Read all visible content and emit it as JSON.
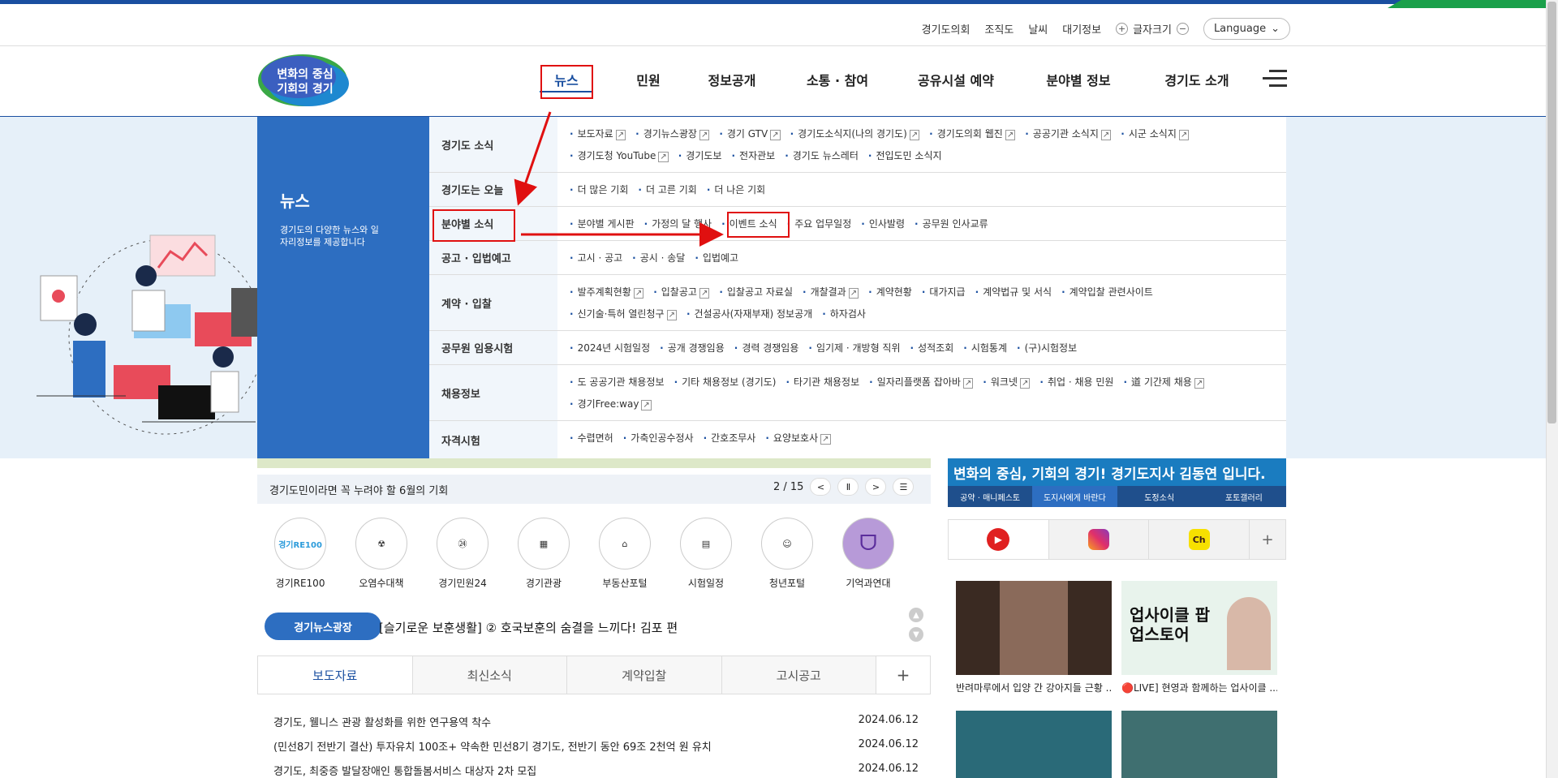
{
  "util": {
    "links": [
      "경기도의회",
      "조직도",
      "날씨",
      "대기정보"
    ],
    "fontsize_label": "글자크기",
    "language": "Language"
  },
  "logo": {
    "line1": "변화의 중심",
    "line2": "기회의 경기"
  },
  "gnb": [
    "뉴스",
    "민원",
    "정보공개",
    "소통 · 참여",
    "공유시설 예약",
    "분야별 정보",
    "경기도 소개"
  ],
  "mega": {
    "title": "뉴스",
    "desc": "경기도의 다양한 뉴스와 일자리정보를 제공합니다",
    "rows": [
      {
        "cat": "경기도 소식",
        "items": [
          "보도자료",
          "경기뉴스광장",
          "경기 GTV",
          "경기도소식지(나의 경기도)",
          "경기도의회 웹진",
          "공공기관 소식지",
          "시군 소식지",
          "경기도청 YouTube",
          "경기도보",
          "전자관보",
          "경기도 뉴스레터",
          "전입도민 소식지"
        ]
      },
      {
        "cat": "경기도는 오늘",
        "items": [
          "더 많은 기회",
          "더 고른 기회",
          "더 나은 기회"
        ]
      },
      {
        "cat": "분야별 소식",
        "items": [
          "분야별 게시판",
          "가정의 달 행사",
          "이벤트 소식",
          "주요 업무일정",
          "인사발령",
          "공무원 인사교류"
        ]
      },
      {
        "cat": "공고 · 입법예고",
        "items": [
          "고시 · 공고",
          "공시 · 송달",
          "입법예고"
        ]
      },
      {
        "cat": "계약 · 입찰",
        "items": [
          "발주계획현황",
          "입찰공고",
          "입찰공고 자료실",
          "개찰결과",
          "계약현황",
          "대가지급",
          "계약법규 및 서식",
          "계약입찰 관련사이트",
          "신기술·특허 열린청구",
          "건설공사(자재부재) 정보공개",
          "하자검사"
        ]
      },
      {
        "cat": "공무원 임용시험",
        "items": [
          "2024년 시험일정",
          "공개 경쟁임용",
          "경력 경쟁임용",
          "임기제 · 개방형 직위",
          "성적조회",
          "시험통계",
          "(구)시험정보"
        ]
      },
      {
        "cat": "채용정보",
        "items": [
          "도 공공기관 채용정보",
          "기타 채용정보 (경기도)",
          "타기관 채용정보",
          "일자리플랫폼 잡아바",
          "워크넷",
          "취업 · 채용 민원",
          "道 기간제 채용",
          "경기Free:way"
        ]
      },
      {
        "cat": "자격시험",
        "items": [
          "수렵면허",
          "가축인공수정사",
          "간호조무사",
          "요양보호사"
        ]
      }
    ]
  },
  "slider": {
    "text": "경기도민이라면 꼭 누려야 할 6월의 기회",
    "counter": "2 / 15"
  },
  "quick": [
    "경기RE100",
    "오염수대책",
    "경기민원24",
    "경기관광",
    "부동산포털",
    "시험일정",
    "청년포털",
    "기억과연대"
  ],
  "quick_icon_text": {
    "re100": "경기RE100"
  },
  "newsplaza": {
    "badge": "경기뉴스광장",
    "headline": "[슬기로운 보훈생활] ② 호국보훈의 숨결을 느끼다! 김포 편"
  },
  "tabs": [
    "보도자료",
    "최신소식",
    "계약입찰",
    "고시공고",
    "+"
  ],
  "news": [
    {
      "title": "경기도, 웰니스 관광 활성화를 위한 연구용역 착수",
      "date": "2024.06.12"
    },
    {
      "title": "(민선8기 전반기 결산) 투자유치 100조+ 약속한 민선8기 경기도, 전반기 동안 69조 2천억 원 유치",
      "date": "2024.06.12"
    },
    {
      "title": "경기도, 최중증 발달장애인 통합돌봄서비스 대상자 2차 모집",
      "date": "2024.06.12"
    }
  ],
  "right": {
    "banner": "변화의 중심, 기회의 경기! 경기도지사 김동연 입니다.",
    "tabs": [
      "공약 · 매니페스토",
      "도지사에게 바란다",
      "도정소식",
      "포토갤러리"
    ],
    "social_plus": "+",
    "thumbs": [
      {
        "caption": "반려마루에서 입양 간 강아지들 근황 ..."
      },
      {
        "caption": "🔴LIVE] 현영과 함께하는 업사이클 ..."
      }
    ],
    "thumb2_title": "업사이클 팝업스토어"
  }
}
